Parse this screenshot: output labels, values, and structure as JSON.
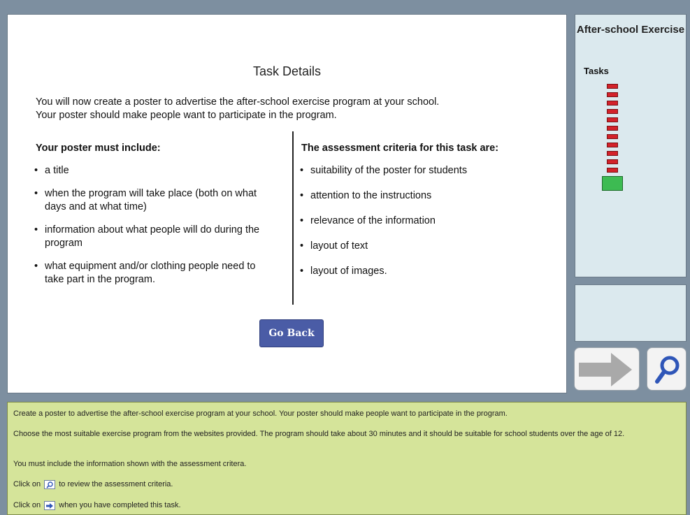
{
  "main": {
    "title": "Task Details",
    "intro_line1": "You will now create a poster to advertise the after-school exercise program at your school.",
    "intro_line2": "Your poster should make people want to participate in the program.",
    "left_heading": "Your poster must include:",
    "left_items": [
      "a title",
      "when the program will take place (both on what days and at what time)",
      "information about what people will do during the program",
      "what equipment and/or clothing people need to take part in the program."
    ],
    "right_heading": "The assessment criteria for this task are:",
    "right_items": [
      "suitability of the poster for students",
      "attention to the instructions",
      "relevance of the information",
      "layout of text",
      "layout of images."
    ],
    "go_back_label": "Go Back"
  },
  "sidebar": {
    "title": "After-school Exercise",
    "tasks_label": "Tasks",
    "tasks_completed_markers": 11,
    "current_task_marker": 1,
    "colors": {
      "completed": "#d3222a",
      "current": "#3dbb52"
    },
    "next_icon": "right-arrow-icon",
    "search_icon": "magnifier-icon"
  },
  "instructions": {
    "line1": "Create a poster to advertise the after-school exercise program at your school. Your poster should make people want to participate in the program.",
    "line2": "Choose the most suitable exercise program from the websites provided. The program should take about 30 minutes and it should be suitable for school students over the age of 12.",
    "line3": "You must include the information shown with the assessment critera.",
    "line4_before": "Click on",
    "line4_after": "to review the assessment criteria.",
    "line5_before": "Click on",
    "line5_after": "when you have completed this task."
  }
}
